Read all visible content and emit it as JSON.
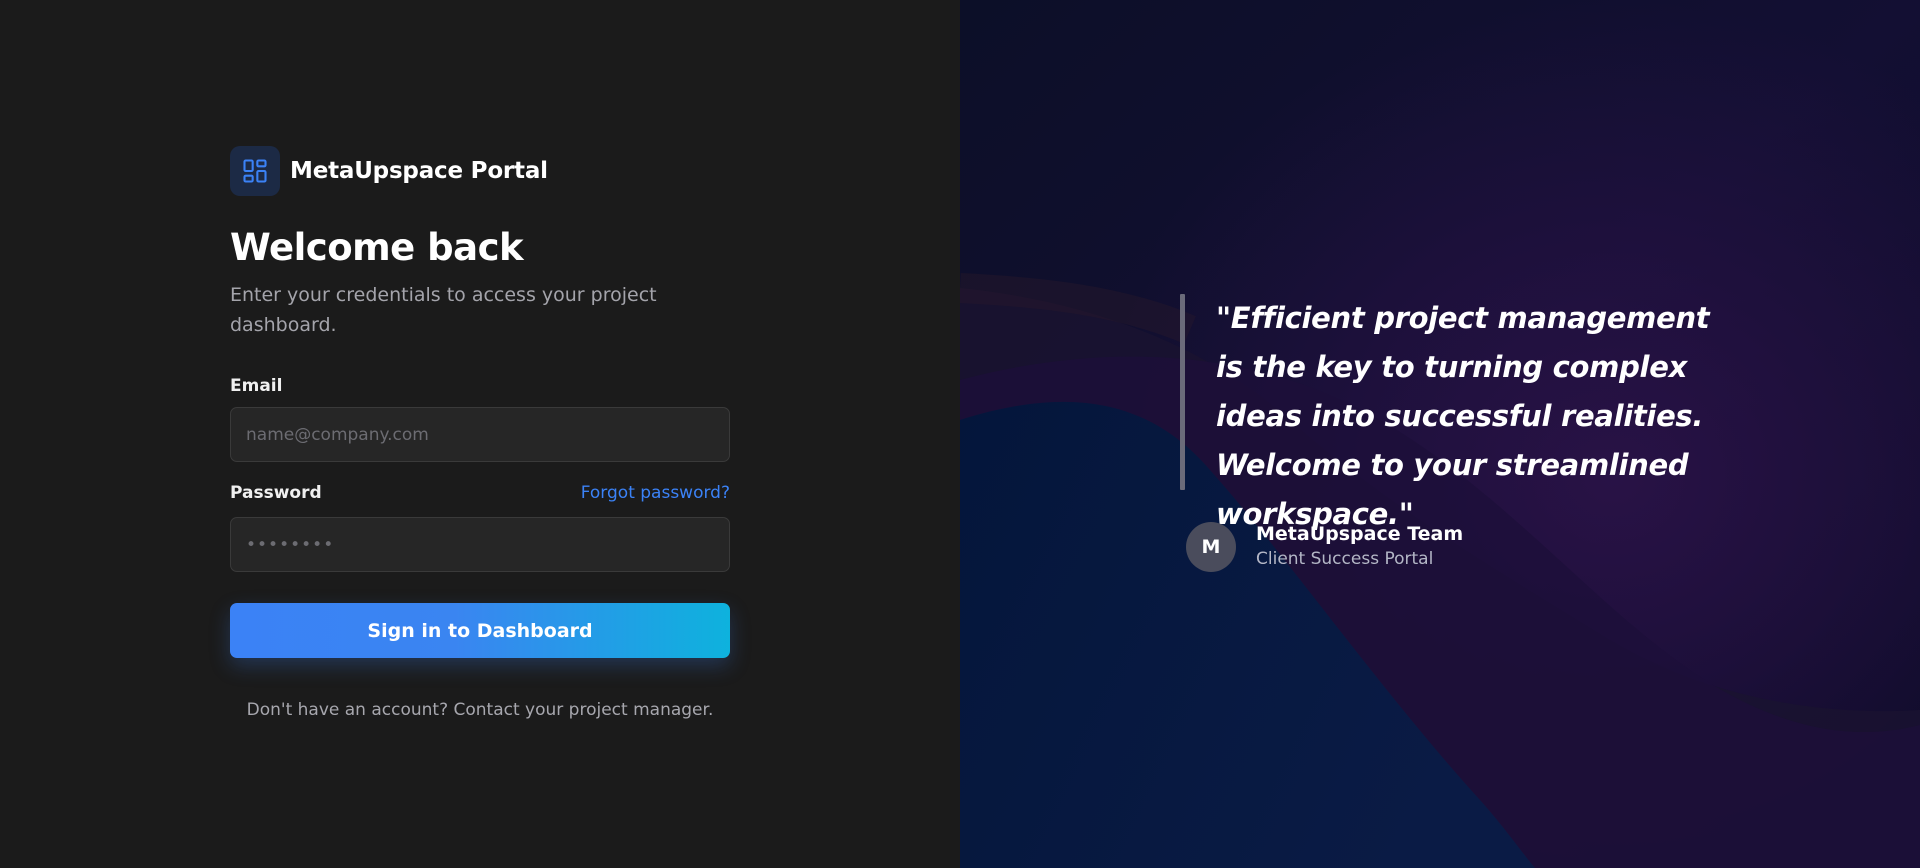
{
  "brand": {
    "name": "MetaUpspace Portal",
    "icon": "dashboard-grid-icon",
    "accent": "#3b82f6"
  },
  "login": {
    "heading": "Welcome back",
    "subtitle": "Enter your credentials to access your project dashboard.",
    "email_label": "Email",
    "email_placeholder": "name@company.com",
    "password_label": "Password",
    "password_value": "••••••••",
    "forgot_link": "Forgot password?",
    "submit_label": "Sign in to Dashboard",
    "footer_note": "Don't have an account? Contact your project manager."
  },
  "testimonial": {
    "quote": "\"Efficient project management is the key to turning complex ideas into successful realities. Welcome to your streamlined workspace.\"",
    "avatar_initial": "M",
    "author_name": "MetaUpspace Team",
    "author_role": "Client Success Portal"
  },
  "colors": {
    "left_bg": "#1b1b1b",
    "right_bg": "#0b0c2c",
    "button_gradient_start": "#3b82f6",
    "button_gradient_end": "#0eb2dd",
    "link": "#3b82f6"
  }
}
